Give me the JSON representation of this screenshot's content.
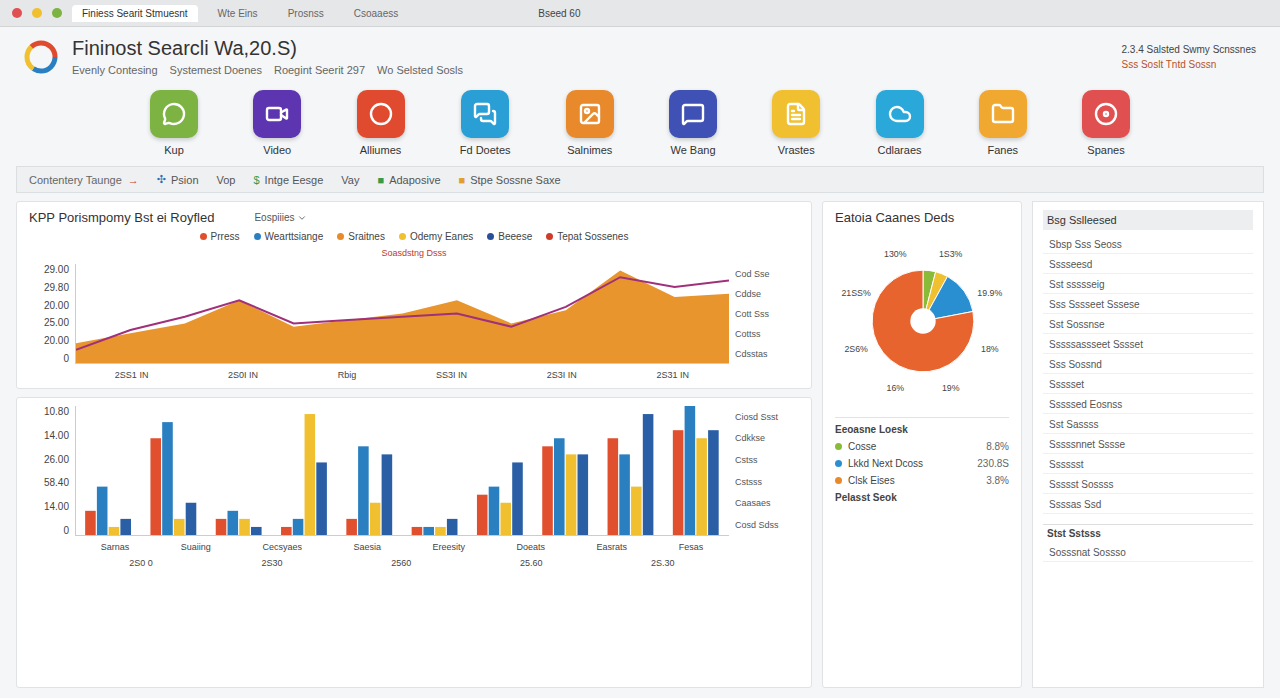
{
  "window": {
    "title": "Bseed 60",
    "tabs": [
      {
        "label": "Finiess Searit Stmuesnt",
        "selected": true
      },
      {
        "label": "Wte Eins",
        "selected": false
      },
      {
        "label": "Prosnss",
        "selected": false
      },
      {
        "label": "Csoaaess",
        "selected": false
      }
    ]
  },
  "header": {
    "title": "Fininost Searcli Wa,20.S)",
    "crumbs": [
      "Evenly Contesing",
      "Systemest Doenes",
      "Roegint Seerit 297",
      "Wo Selsted Sosls"
    ],
    "notice": [
      "2.3.4 Salsted Swmy Scnssnes",
      "Sss Soslt Tntd Sossn"
    ]
  },
  "apps": [
    {
      "label": "Kup",
      "color": "#7cb342"
    },
    {
      "label": "Video",
      "color": "#5e35b1"
    },
    {
      "label": "Alliumes",
      "color": "#e04a2f"
    },
    {
      "label": "Fd Doetes",
      "color": "#2a9fd6"
    },
    {
      "label": "Salnimes",
      "color": "#e8892b"
    },
    {
      "label": "We Bang",
      "color": "#3f51b5"
    },
    {
      "label": "Vrastes",
      "color": "#f0c030"
    },
    {
      "label": "Cdlaraes",
      "color": "#29a8d9"
    },
    {
      "label": "Fanes",
      "color": "#f0a830"
    },
    {
      "label": "Spanes",
      "color": "#e05050"
    }
  ],
  "toolbar": {
    "title": "Contentery Taunge",
    "arrow": "→",
    "items": [
      {
        "kind": "mark",
        "mark": "✣",
        "label": "Psion",
        "color": "#2a6fb5"
      },
      {
        "kind": "plain",
        "label": "Vop"
      },
      {
        "kind": "mark",
        "mark": "$",
        "label": "Intge Eesge",
        "color": "#3a9a4a"
      },
      {
        "kind": "plain",
        "label": "Vay"
      },
      {
        "kind": "mark",
        "mark": "■",
        "label": "Adaposive",
        "color": "#3a9a4a"
      },
      {
        "kind": "mark",
        "mark": "■",
        "label": "Stpe Sossne Saxe",
        "color": "#e0a030"
      }
    ]
  },
  "area_chart": {
    "title": "KPP Porismpomy Bst ei Royfled",
    "filter": "Eospiiies",
    "caption": "Soasdstng Dsss",
    "legend": [
      {
        "label": "Prress",
        "color": "#e0502f"
      },
      {
        "label": "Wearttsiange",
        "color": "#2a7fc1"
      },
      {
        "label": "Sraitnes",
        "color": "#e8892b"
      },
      {
        "label": "Odemy Eanes",
        "color": "#f0c030"
      },
      {
        "label": "Beeese",
        "color": "#2a4f9a"
      },
      {
        "label": "Tepat Sossenes",
        "color": "#d03a2a"
      }
    ],
    "y_ticks": [
      "29.00",
      "29.80",
      "20.00",
      "25.00",
      "20.00",
      "0"
    ],
    "x_ticks": [
      "2SS1 IN",
      "2S0I IN",
      "Rbig",
      "SS3I IN",
      "2S3I IN",
      "2S31 IN"
    ],
    "side_labels": [
      "Cod Sse",
      "Cddse",
      "Cott Sss",
      "Cottss",
      "Cdsstas"
    ],
    "max": 30,
    "series": [
      {
        "kind": "area",
        "color": "#e8952e",
        "values": [
          6,
          9,
          12,
          19,
          11,
          13,
          15,
          19,
          12,
          16,
          28,
          20,
          21
        ]
      },
      {
        "kind": "line",
        "color": "#a0307a",
        "values": [
          4,
          10,
          14,
          19,
          12,
          13,
          14,
          15,
          11,
          17,
          26,
          23,
          25
        ]
      }
    ]
  },
  "bar_chart": {
    "y_ticks": [
      "10.80",
      "14.00",
      "26.00",
      "58.40",
      "14.00",
      "0"
    ],
    "x_ticks": [
      "Sarnas",
      "Suaiing",
      "Cecsyaes",
      "Saesia",
      "Ereesity",
      "Doeats",
      "Easrats",
      "Fesas"
    ],
    "x_sub": [
      "2S0 0",
      "2S30",
      "2560",
      "25.60",
      "2S.30"
    ],
    "side_labels": [
      "Ciosd Ssst",
      "Cdkkse",
      "Cstss",
      "Cstsss",
      "Caasaes",
      "Cosd Sdss"
    ],
    "max": 16,
    "series": [
      {
        "color": "#e0502f",
        "values": [
          3,
          12,
          2,
          1,
          2,
          1,
          5,
          11,
          12,
          13
        ]
      },
      {
        "color": "#2a7fc1",
        "values": [
          6,
          14,
          3,
          2,
          11,
          1,
          6,
          12,
          10,
          16
        ]
      },
      {
        "color": "#f0c030",
        "values": [
          1,
          2,
          2,
          15,
          4,
          1,
          4,
          10,
          6,
          12
        ]
      },
      {
        "color": "#2a5fa5",
        "values": [
          2,
          4,
          1,
          9,
          10,
          2,
          9,
          10,
          15,
          13
        ]
      }
    ]
  },
  "pie_chart": {
    "title": "Eatoia Caanes Deds",
    "slices": [
      {
        "value": 4,
        "color": "#8aba3a"
      },
      {
        "value": 4,
        "color": "#f0c030"
      },
      {
        "value": 14,
        "color": "#2a8fd0"
      },
      {
        "value": 78,
        "color": "#e8642e"
      }
    ],
    "labels": [
      "1S3%",
      "19.9%",
      "18%",
      "19%",
      "16%",
      "2S6%",
      "21SS%",
      "130%"
    ],
    "legend_title": "Eeoasne Loesk",
    "legend": [
      {
        "label": "Cosse",
        "value": "8.8%",
        "color": "#8aba3a"
      },
      {
        "label": "Lkkd Next Dcoss",
        "value": "230.8S",
        "color": "#2a8fd0"
      },
      {
        "label": "Clsk Eises",
        "value": "3.8%",
        "color": "#e8892b"
      }
    ],
    "footer": "Pelasst Seok"
  },
  "sidebar": {
    "title": "Bsg Sslleesed",
    "items": [
      "Sbsp Sss Seoss",
      "Sssseesd",
      "Sst ssssseig",
      "Sss Sssseet Sssese",
      "Sst Sossnse",
      "Sssssassseet Sssset",
      "Sss Sossnd",
      "Ssssset",
      "Sssssed Eosnss",
      "Sst Sassss",
      "Sssssnnet Sssse",
      "Sssssst",
      "Ssssst Sossss",
      "Ssssas Ssd"
    ],
    "section": "Stst Sstsss",
    "section_item": "Sosssnat Sossso"
  }
}
